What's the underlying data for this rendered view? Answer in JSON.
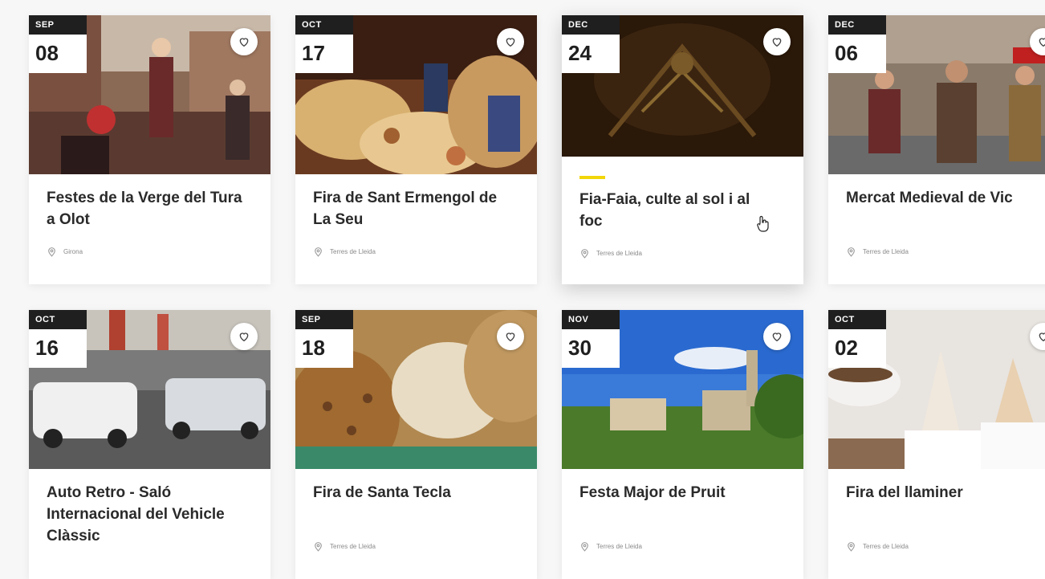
{
  "accent_color": "#f2d60a",
  "favorite_icon": "heart-icon",
  "location_icon": "map-pin-icon",
  "events": [
    {
      "month": "SEP",
      "day": "08",
      "title": "Festes de la Verge del Tura a Olot",
      "location": "Girona"
    },
    {
      "month": "OCT",
      "day": "17",
      "title": "Fira de Sant Ermengol de La Seu",
      "location": "Terres de Lleida"
    },
    {
      "month": "DEC",
      "day": "24",
      "title": "Fia-Faia, culte al sol i al foc",
      "location": "Terres de Lleida"
    },
    {
      "month": "DEC",
      "day": "06",
      "title": "Mercat Medieval de Vic",
      "location": "Terres de Lleida"
    },
    {
      "month": "OCT",
      "day": "16",
      "title": "Auto Retro - Saló Internacional del Vehicle Clàssic",
      "location": "Terres de Lleida"
    },
    {
      "month": "SEP",
      "day": "18",
      "title": "Fira de Santa Tecla",
      "location": "Terres de Lleida"
    },
    {
      "month": "NOV",
      "day": "30",
      "title": "Festa Major de Pruit",
      "location": "Terres de Lleida"
    },
    {
      "month": "OCT",
      "day": "02",
      "title": "Fira del llaminer",
      "location": "Terres de Lleida"
    }
  ]
}
